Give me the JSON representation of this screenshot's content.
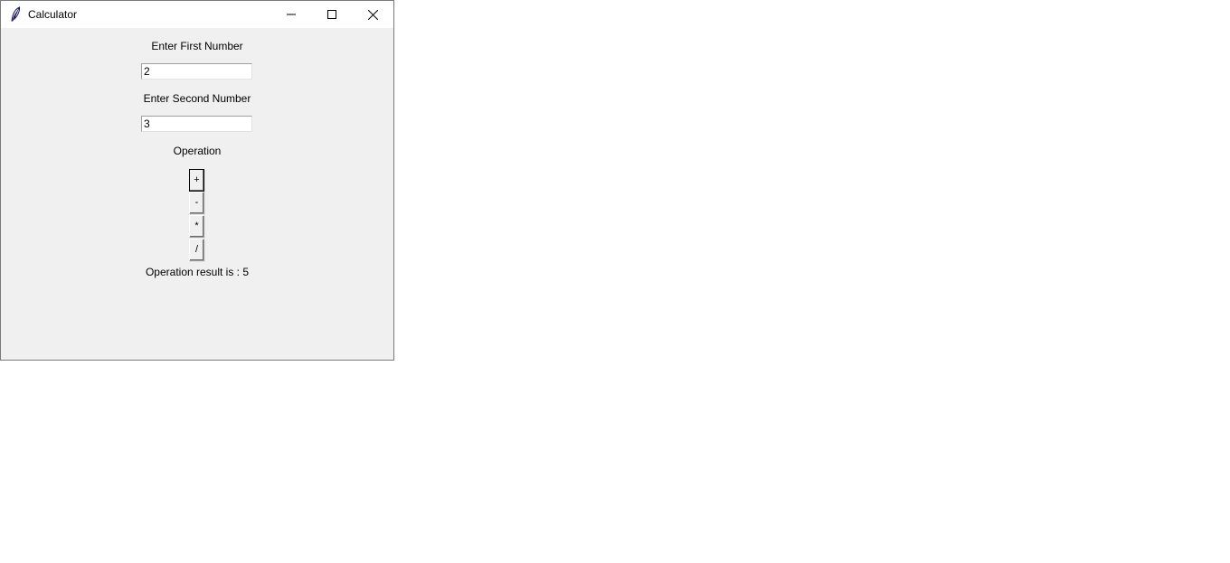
{
  "window": {
    "title": "Calculator",
    "app_icon": "feather-icon",
    "controls": {
      "minimize_icon": "minimize-icon",
      "maximize_icon": "maximize-icon",
      "close_icon": "close-icon"
    }
  },
  "form": {
    "first_label": "Enter First Number",
    "first_value": "2",
    "second_label": "Enter Second Number",
    "second_value": "3",
    "operation_label": "Operation",
    "operations": [
      "+",
      "-",
      "*",
      "/"
    ],
    "result_text": "Operation result is : 5"
  },
  "colors": {
    "window_bg": "#f0f0f0",
    "titlebar_bg": "#ffffff"
  }
}
